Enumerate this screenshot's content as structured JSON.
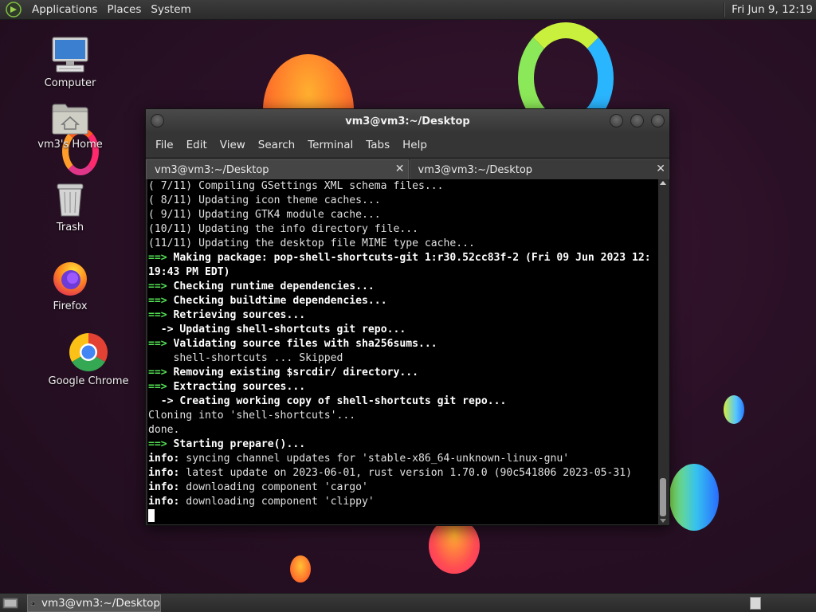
{
  "top_panel": {
    "menus": [
      "Applications",
      "Places",
      "System"
    ],
    "clock": "Fri Jun  9, 12:19"
  },
  "desktop": {
    "icons": [
      {
        "label": "Computer",
        "icon": "computer-icon"
      },
      {
        "label": "vm3's Home",
        "icon": "home-folder-icon"
      },
      {
        "label": "Trash",
        "icon": "trash-icon"
      },
      {
        "label": "Firefox",
        "icon": "firefox-icon"
      },
      {
        "label": "Google Chrome",
        "icon": "chrome-icon"
      }
    ]
  },
  "terminal": {
    "title": "vm3@vm3:~/Desktop",
    "menu": [
      "File",
      "Edit",
      "View",
      "Search",
      "Terminal",
      "Tabs",
      "Help"
    ],
    "tabs": [
      {
        "label": "vm3@vm3:~/Desktop",
        "active": true
      },
      {
        "label": "vm3@vm3:~/Desktop",
        "active": false
      }
    ],
    "lines": [
      [
        [
          "n",
          "( 7/11) Compiling GSettings XML schema files..."
        ]
      ],
      [
        [
          "n",
          "( 8/11) Updating icon theme caches..."
        ]
      ],
      [
        [
          "n",
          "( 9/11) Updating GTK4 module cache..."
        ]
      ],
      [
        [
          "n",
          "(10/11) Updating the info directory file..."
        ]
      ],
      [
        [
          "n",
          "(11/11) Updating the desktop file MIME type cache..."
        ]
      ],
      [
        [
          "g",
          "==> "
        ],
        [
          "b",
          "Making package: pop-shell-shortcuts-git 1:r30.52cc83f-2 (Fri 09 Jun 2023 12:"
        ]
      ],
      [
        [
          "b",
          "19:43 PM EDT)"
        ]
      ],
      [
        [
          "g",
          "==> "
        ],
        [
          "b",
          "Checking runtime dependencies..."
        ]
      ],
      [
        [
          "g",
          "==> "
        ],
        [
          "b",
          "Checking buildtime dependencies..."
        ]
      ],
      [
        [
          "g",
          "==> "
        ],
        [
          "b",
          "Retrieving sources..."
        ]
      ],
      [
        [
          "n",
          "  "
        ],
        [
          "b",
          "-> Updating shell-shortcuts git repo..."
        ]
      ],
      [
        [
          "g",
          "==> "
        ],
        [
          "b",
          "Validating source files with sha256sums..."
        ]
      ],
      [
        [
          "n",
          "    shell-shortcuts ... Skipped"
        ]
      ],
      [
        [
          "g",
          "==> "
        ],
        [
          "b",
          "Removing existing $srcdir/ directory..."
        ]
      ],
      [
        [
          "g",
          "==> "
        ],
        [
          "b",
          "Extracting sources..."
        ]
      ],
      [
        [
          "n",
          "  "
        ],
        [
          "b",
          "-> Creating working copy of shell-shortcuts git repo..."
        ]
      ],
      [
        [
          "n",
          "Cloning into 'shell-shortcuts'..."
        ]
      ],
      [
        [
          "n",
          "done."
        ]
      ],
      [
        [
          "g",
          "==> "
        ],
        [
          "b",
          "Starting prepare()..."
        ]
      ],
      [
        [
          "b",
          "info:"
        ],
        [
          "n",
          " syncing channel updates for 'stable-x86_64-unknown-linux-gnu'"
        ]
      ],
      [
        [
          "b",
          "info:"
        ],
        [
          "n",
          " latest update on 2023-06-01, rust version 1.70.0 (90c541806 2023-05-31)"
        ]
      ],
      [
        [
          "b",
          "info:"
        ],
        [
          "n",
          " downloading component 'cargo'"
        ]
      ],
      [
        [
          "b",
          "info:"
        ],
        [
          "n",
          " downloading component 'clippy'"
        ]
      ]
    ]
  },
  "taskbar": {
    "items": [
      {
        "label": "vm3@vm3:~/Desktop",
        "icon": "terminal-icon"
      }
    ]
  }
}
